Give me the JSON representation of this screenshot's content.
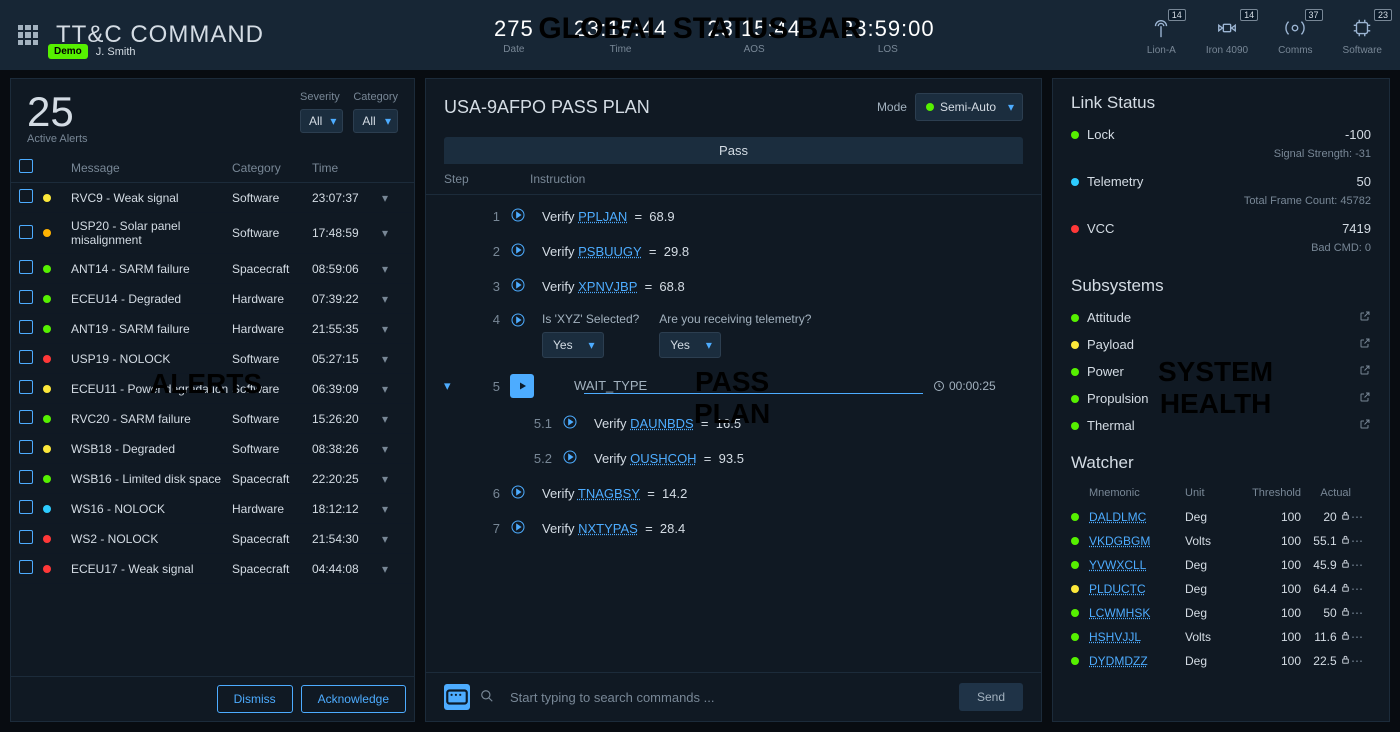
{
  "overlays": {
    "gsb": "GLOBAL STATUS BAR",
    "alerts": "ALERTS",
    "pass_plan_l1": "PASS",
    "pass_plan_l2": "PLAN",
    "sys_health_l1": "SYSTEM",
    "sys_health_l2": "HEALTH"
  },
  "gsb": {
    "title_bold": "TT&C",
    "title_light": "COMMAND",
    "badge": "Demo",
    "user": "J. Smith",
    "clocks": [
      {
        "val": "275",
        "lbl": "Date"
      },
      {
        "val": "23:15:44",
        "lbl": "Time"
      },
      {
        "val": "23:15:44",
        "lbl": "AOS"
      },
      {
        "val": "23:59:00",
        "lbl": "LOS"
      }
    ],
    "stats": [
      {
        "name": "Lion-A",
        "dot": "sd-green",
        "count": "14",
        "icon": "antenna"
      },
      {
        "name": "Iron 4090",
        "dot": "sd-yellow",
        "count": "14",
        "icon": "satellite"
      },
      {
        "name": "Comms",
        "dot": "sd-red",
        "count": "37",
        "icon": "radio"
      },
      {
        "name": "Software",
        "dot": "sd-green",
        "count": "23",
        "icon": "chip"
      }
    ]
  },
  "alerts": {
    "count_val": "25",
    "count_lbl": "Active Alerts",
    "filters": {
      "sev_lbl": "Severity",
      "sev_val": "All",
      "cat_lbl": "Category",
      "cat_val": "All"
    },
    "cols": {
      "msg": "Message",
      "cat": "Category",
      "time": "Time"
    },
    "rows": [
      {
        "d": "sd-yellow",
        "msg": "RVC9 - Weak signal",
        "cat": "Software",
        "time": "23:07:37"
      },
      {
        "d": "sd-orange",
        "msg": "USP20 - Solar panel misalignment",
        "cat": "Software",
        "time": "17:48:59"
      },
      {
        "d": "sd-green",
        "msg": "ANT14 - SARM failure",
        "cat": "Spacecraft",
        "time": "08:59:06"
      },
      {
        "d": "sd-green",
        "msg": "ECEU14 - Degraded",
        "cat": "Hardware",
        "time": "07:39:22"
      },
      {
        "d": "sd-green",
        "msg": "ANT19 - SARM failure",
        "cat": "Hardware",
        "time": "21:55:35"
      },
      {
        "d": "sd-red",
        "msg": "USP19 - NOLOCK",
        "cat": "Software",
        "time": "05:27:15"
      },
      {
        "d": "sd-yellow",
        "msg": "ECEU11 - Power degradation",
        "cat": "Software",
        "time": "06:39:09"
      },
      {
        "d": "sd-green",
        "msg": "RVC20 - SARM failure",
        "cat": "Software",
        "time": "15:26:20"
      },
      {
        "d": "sd-yellow",
        "msg": "WSB18 - Degraded",
        "cat": "Software",
        "time": "08:38:26"
      },
      {
        "d": "sd-green",
        "msg": "WSB16 - Limited disk space",
        "cat": "Spacecraft",
        "time": "22:20:25"
      },
      {
        "d": "sd-cyan",
        "msg": "WS16 - NOLOCK",
        "cat": "Hardware",
        "time": "18:12:12"
      },
      {
        "d": "sd-red",
        "msg": "WS2 - NOLOCK",
        "cat": "Spacecraft",
        "time": "21:54:30"
      },
      {
        "d": "sd-red",
        "msg": "ECEU17 - Weak signal",
        "cat": "Spacecraft",
        "time": "04:44:08"
      }
    ],
    "btn_dismiss": "Dismiss",
    "btn_ack": "Acknowledge"
  },
  "passplan": {
    "title": "USA-9AFPO PASS PLAN",
    "mode_lbl": "Mode",
    "mode_val": "Semi-Auto",
    "tab": "Pass",
    "cols": {
      "step": "Step",
      "instr": "Instruction"
    },
    "verify": "Verify",
    "eq": "=",
    "steps": [
      {
        "n": "1",
        "mn": "PPLJAN",
        "v": "68.9"
      },
      {
        "n": "2",
        "mn": "PSBUUGY",
        "v": "29.8"
      },
      {
        "n": "3",
        "mn": "XPNVJBP",
        "v": "68.8"
      }
    ],
    "q1": "Is 'XYZ' Selected?",
    "q2": "Are you receiving telemetry?",
    "q_ans": "Yes",
    "step4": "4",
    "step5": "5",
    "wait": "WAIT_TYPE",
    "timer": "00:00:25",
    "sub_steps": [
      {
        "n": "5.1",
        "mn": "DAUNBDS",
        "v": "16.5"
      },
      {
        "n": "5.2",
        "mn": "OUSHCOH",
        "v": "93.5"
      }
    ],
    "late_steps": [
      {
        "n": "6",
        "mn": "TNAGBSY",
        "v": "14.2"
      },
      {
        "n": "7",
        "mn": "NXTYPAS",
        "v": "28.4"
      }
    ],
    "search_placeholder": "Start typing to search commands ...",
    "send": "Send"
  },
  "health": {
    "link_title": "Link Status",
    "link": [
      {
        "d": "sd-green",
        "name": "Lock",
        "val": "-100",
        "sub": "Signal Strength: -31"
      },
      {
        "d": "sd-cyan",
        "name": "Telemetry",
        "val": "50",
        "sub": "Total Frame Count: 45782"
      },
      {
        "d": "sd-red",
        "name": "VCC",
        "val": "7419",
        "sub": "Bad CMD: 0"
      }
    ],
    "sub_title": "Subsystems",
    "subs": [
      {
        "d": "sd-green",
        "name": "Attitude"
      },
      {
        "d": "sd-yellow",
        "name": "Payload"
      },
      {
        "d": "sd-green",
        "name": "Power"
      },
      {
        "d": "sd-green",
        "name": "Propulsion"
      },
      {
        "d": "sd-green",
        "name": "Thermal"
      }
    ],
    "watch_title": "Watcher",
    "watch_cols": {
      "mn": "Mnemonic",
      "unit": "Unit",
      "thr": "Threshold",
      "act": "Actual"
    },
    "watch": [
      {
        "d": "sd-green",
        "mn": "DALDLMC",
        "unit": "Deg",
        "thr": "100",
        "act": "20",
        "lock": true
      },
      {
        "d": "sd-green",
        "mn": "VKDGBGM",
        "unit": "Volts",
        "thr": "100",
        "act": "55.1",
        "lock": true
      },
      {
        "d": "sd-green",
        "mn": "YVWXCLL",
        "unit": "Deg",
        "thr": "100",
        "act": "45.9",
        "lock": true
      },
      {
        "d": "sd-yellow",
        "mn": "PLDUCTC",
        "unit": "Deg",
        "thr": "100",
        "act": "64.4",
        "lock": true
      },
      {
        "d": "sd-green",
        "mn": "LCWMHSK",
        "unit": "Deg",
        "thr": "100",
        "act": "50",
        "lock": true
      },
      {
        "d": "sd-green",
        "mn": "HSHVJJL",
        "unit": "Volts",
        "thr": "100",
        "act": "11.6",
        "lock": true
      },
      {
        "d": "sd-green",
        "mn": "DYDMDZZ",
        "unit": "Deg",
        "thr": "100",
        "act": "22.5",
        "lock": true
      }
    ]
  }
}
